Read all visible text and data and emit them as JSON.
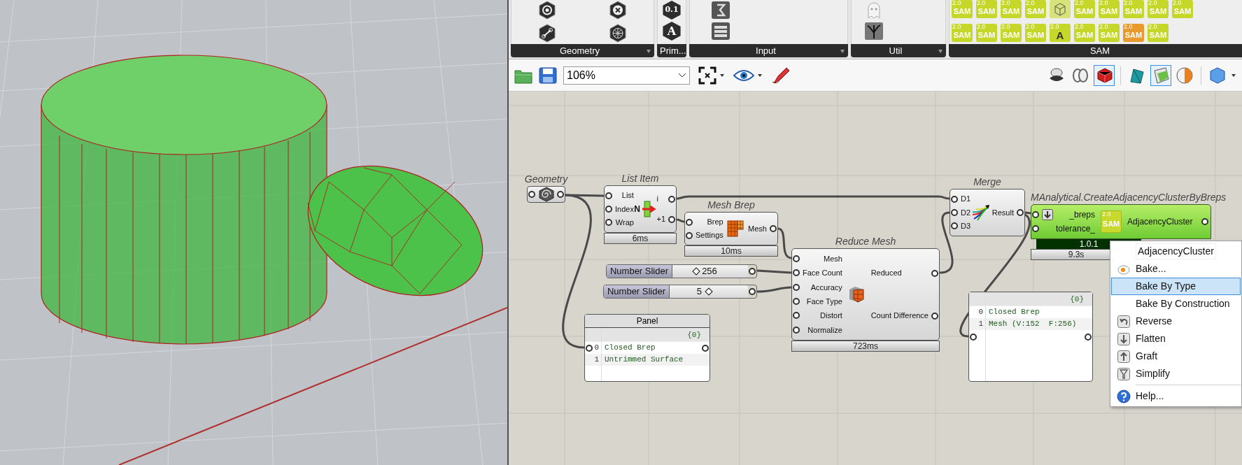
{
  "ribbon": {
    "sections": [
      {
        "label": "Geometry",
        "icons": [
          {
            "kind": "hex"
          },
          {
            "kind": "hex-cross"
          },
          {
            "kind": "hex-line"
          },
          {
            "kind": "hex-star"
          }
        ]
      },
      {
        "label": "Prim...",
        "icons": [
          {
            "kind": "hex-text",
            "label": "0.1"
          },
          {
            "kind": "hex-text",
            "label": "A"
          }
        ]
      },
      {
        "label": "Input",
        "icons": [
          {
            "kind": "slider-tile"
          },
          {
            "kind": "list-tile"
          }
        ]
      },
      {
        "label": "Util",
        "icons": [
          {
            "kind": "ghost"
          },
          {
            "kind": "tree"
          }
        ]
      },
      {
        "label": "SAM",
        "icons": [
          {
            "kind": "sam",
            "label": "SAM",
            "badge": "2.0"
          },
          {
            "kind": "sam",
            "label": "SAM",
            "badge": "2.0"
          },
          {
            "kind": "sam",
            "label": "SAM",
            "badge": "2.0"
          },
          {
            "kind": "sam",
            "label": "SAM",
            "badge": "2.0"
          },
          {
            "kind": "cube"
          },
          {
            "kind": "sam",
            "label": "SAM",
            "badge": "2.0"
          },
          {
            "kind": "sam",
            "label": "SAM",
            "badge": "2.0"
          },
          {
            "kind": "sam",
            "label": "SAM",
            "badge": "2.0"
          },
          {
            "kind": "sam",
            "label": "SAM",
            "badge": "2.0"
          },
          {
            "kind": "sam",
            "label": "SAM",
            "badge": "2.0"
          },
          {
            "kind": "sam",
            "label": "SAM",
            "badge": "2.0"
          },
          {
            "kind": "sam",
            "label": "SAM",
            "badge": "2.0"
          },
          {
            "kind": "sam",
            "label": "SAM",
            "badge": "2.0"
          },
          {
            "kind": "sam",
            "label": "SAM",
            "badge": "2.0"
          },
          {
            "kind": "sam",
            "label": "A",
            "badge": "2.0"
          },
          {
            "kind": "sam",
            "label": "SAM",
            "badge": "2.0"
          },
          {
            "kind": "sam",
            "label": "SAM",
            "badge": "2.0"
          },
          {
            "kind": "sam-orange",
            "label": "SAM",
            "badge": "2.0"
          },
          {
            "kind": "sam",
            "label": "SAM",
            "badge": "2.0"
          }
        ]
      }
    ]
  },
  "toolbar": {
    "zoom": "106%",
    "toggles": [
      {
        "kind": "eye-cap",
        "selected": false
      },
      {
        "kind": "rings",
        "selected": false
      },
      {
        "kind": "red-cube",
        "selected": true
      },
      {
        "kind": "teal",
        "selected": false
      },
      {
        "kind": "green",
        "selected": true
      },
      {
        "kind": "orange-sphere",
        "selected": false
      },
      {
        "kind": "blue-hex",
        "selected": false
      }
    ]
  },
  "canvas": {
    "nodes": [
      {
        "kind": "param",
        "title": "Geometry"
      },
      {
        "kind": "component",
        "title": "List Item",
        "icon_label": "N",
        "inputs": [
          "List",
          "Index",
          "Wrap"
        ],
        "outputs": [
          "i",
          "+1"
        ],
        "timing": "6ms"
      },
      {
        "kind": "component",
        "title": "Mesh Brep",
        "inputs": [
          "Brep",
          "Settings"
        ],
        "outputs": [
          "Mesh"
        ],
        "timing": "10ms"
      },
      {
        "kind": "slider",
        "label": "Number Slider",
        "value": "256",
        "level": 0.27
      },
      {
        "kind": "slider",
        "label": "Number Slider",
        "value": "5",
        "level": 0.5
      },
      {
        "kind": "panel",
        "title": "Panel",
        "path": "{0}",
        "rows": [
          {
            "index": "0",
            "text": "Closed Brep"
          },
          {
            "index": "1",
            "text": "Untrimmed Surface"
          }
        ]
      },
      {
        "kind": "component",
        "title": "Reduce Mesh",
        "inputs": [
          "Mesh",
          "Face Count",
          "Accuracy",
          "Face Type",
          "Distort",
          "Normalize"
        ],
        "outputs": [
          "Reduced",
          "Count Difference"
        ],
        "timing": "723ms"
      },
      {
        "kind": "component",
        "title": "Merge",
        "inputs": [
          "D1",
          "D2",
          "D3"
        ],
        "outputs": [
          "Result"
        ]
      },
      {
        "kind": "cluster",
        "title": "MAnalytical.CreateAdjacencyClusterByBreps",
        "inputs": [
          "_breps",
          "tolerance_"
        ],
        "outputs": [
          "AdjacencyCluster"
        ],
        "icon_label": "SAM",
        "icon_badge": "2.0",
        "version": "1.0.1",
        "timing": "9.3s"
      },
      {
        "kind": "panel",
        "path": "{0}",
        "rows": [
          {
            "index": "0",
            "text": "Closed Brep"
          },
          {
            "index": "1",
            "text": "Mesh (V:152  F:256)"
          }
        ]
      }
    ],
    "menu": {
      "items": [
        {
          "kind": "name",
          "label": "AdjacencyCluster",
          "selected": false
        },
        {
          "kind": "bake",
          "label": "Bake...",
          "selected": false
        },
        {
          "kind": "plain",
          "label": "Bake By Type",
          "selected": true
        },
        {
          "kind": "plain",
          "label": "Bake By Construction",
          "selected": false
        },
        {
          "kind": "reverse",
          "label": "Reverse",
          "selected": false
        },
        {
          "kind": "flatten",
          "label": "Flatten",
          "selected": false
        },
        {
          "kind": "graft",
          "label": "Graft",
          "selected": false
        },
        {
          "kind": "simplify",
          "label": "Simplify",
          "selected": false
        },
        {
          "kind": "help",
          "label": "Help...",
          "selected": false
        }
      ]
    }
  }
}
